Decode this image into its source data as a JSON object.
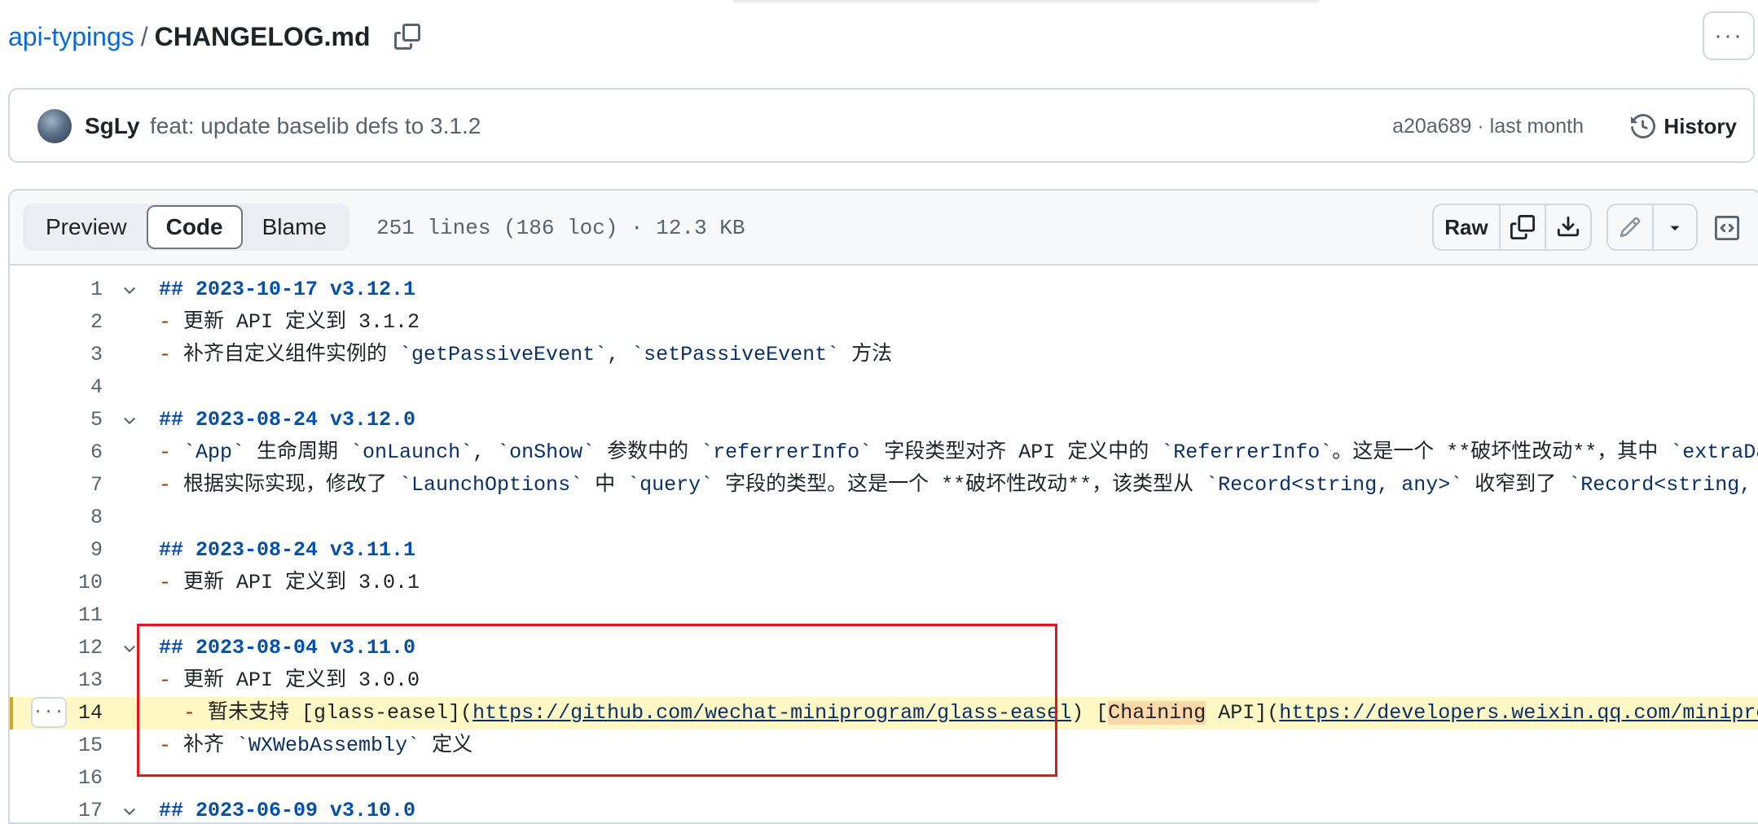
{
  "breadcrumb": {
    "repo": "api-typings",
    "separator": "/",
    "file": "CHANGELOG.md"
  },
  "commit": {
    "author": "SgLy",
    "message": "feat: update baselib defs to 3.1.2",
    "meta": "a20a689 · last month",
    "history_label": "History"
  },
  "toolbar": {
    "tabs": [
      {
        "label": "Preview",
        "active": false
      },
      {
        "label": "Code",
        "active": true
      },
      {
        "label": "Blame",
        "active": false
      }
    ],
    "file_info": "251 lines (186 loc) · 12.3 KB",
    "raw_label": "Raw"
  },
  "lines": [
    {
      "n": "1",
      "fold": true,
      "parts": [
        {
          "t": "## 2023-10-17 v3.12.1",
          "c": "h"
        }
      ]
    },
    {
      "n": "2",
      "parts": [
        {
          "t": "- ",
          "c": "m"
        },
        {
          "t": "更新 API 定义到 3.1.2"
        }
      ]
    },
    {
      "n": "3",
      "parts": [
        {
          "t": "- ",
          "c": "m"
        },
        {
          "t": "补齐自定义组件实例的 "
        },
        {
          "t": "`getPassiveEvent`",
          "c": "c"
        },
        {
          "t": ", "
        },
        {
          "t": "`setPassiveEvent`",
          "c": "c"
        },
        {
          "t": " 方法"
        }
      ]
    },
    {
      "n": "4",
      "parts": []
    },
    {
      "n": "5",
      "fold": true,
      "parts": [
        {
          "t": "## 2023-08-24 v3.12.0",
          "c": "h"
        }
      ]
    },
    {
      "n": "6",
      "parts": [
        {
          "t": "- ",
          "c": "m"
        },
        {
          "t": "`App`",
          "c": "c"
        },
        {
          "t": " 生命周期 "
        },
        {
          "t": "`onLaunch`",
          "c": "c"
        },
        {
          "t": ", "
        },
        {
          "t": "`onShow`",
          "c": "c"
        },
        {
          "t": " 参数中的 "
        },
        {
          "t": "`referrerInfo`",
          "c": "c"
        },
        {
          "t": " 字段类型对齐 API 定义中的 "
        },
        {
          "t": "`ReferrerInfo`",
          "c": "c"
        },
        {
          "t": "。这是一个 **破坏性改动**，其中 "
        },
        {
          "t": "`extraData`",
          "c": "c"
        }
      ]
    },
    {
      "n": "7",
      "parts": [
        {
          "t": "- ",
          "c": "m"
        },
        {
          "t": "根据实际实现，修改了 "
        },
        {
          "t": "`LaunchOptions`",
          "c": "c"
        },
        {
          "t": " 中 "
        },
        {
          "t": "`query`",
          "c": "c"
        },
        {
          "t": " 字段的类型。这是一个 **破坏性改动**，该类型从 "
        },
        {
          "t": "`Record<string, any>`",
          "c": "c"
        },
        {
          "t": " 收窄到了 "
        },
        {
          "t": "`Record<string, string>`",
          "c": "c"
        }
      ]
    },
    {
      "n": "8",
      "parts": []
    },
    {
      "n": "9",
      "parts": [
        {
          "t": "## 2023-08-24 v3.11.1",
          "c": "h"
        }
      ]
    },
    {
      "n": "10",
      "parts": [
        {
          "t": "- ",
          "c": "m"
        },
        {
          "t": "更新 API 定义到 3.0.1"
        }
      ]
    },
    {
      "n": "11",
      "parts": []
    },
    {
      "n": "12",
      "fold": true,
      "parts": [
        {
          "t": "## 2023-08-04 v3.11.0",
          "c": "h"
        }
      ]
    },
    {
      "n": "13",
      "parts": [
        {
          "t": "- ",
          "c": "m"
        },
        {
          "t": "更新 API 定义到 3.0.0"
        }
      ]
    },
    {
      "n": "14",
      "highlight": true,
      "parts": [
        {
          "t": "  - ",
          "c": "m"
        },
        {
          "t": "暂未支持 [glass-easel]("
        },
        {
          "t": "https://github.com/wechat-miniprogram/glass-easel",
          "c": "lk"
        },
        {
          "t": ") ["
        },
        {
          "t": "Chaining",
          "c": "mark"
        },
        {
          "t": " API]("
        },
        {
          "t": "https://developers.weixin.qq.com/miniprogram",
          "c": "lk"
        }
      ]
    },
    {
      "n": "15",
      "parts": [
        {
          "t": "- ",
          "c": "m"
        },
        {
          "t": "补齐 "
        },
        {
          "t": "`WXWebAssembly`",
          "c": "c"
        },
        {
          "t": " 定义"
        }
      ]
    },
    {
      "n": "16",
      "parts": []
    },
    {
      "n": "17",
      "fold": true,
      "parts": [
        {
          "t": "## 2023-06-09 v3.10.0",
          "c": "h"
        }
      ]
    }
  ]
}
